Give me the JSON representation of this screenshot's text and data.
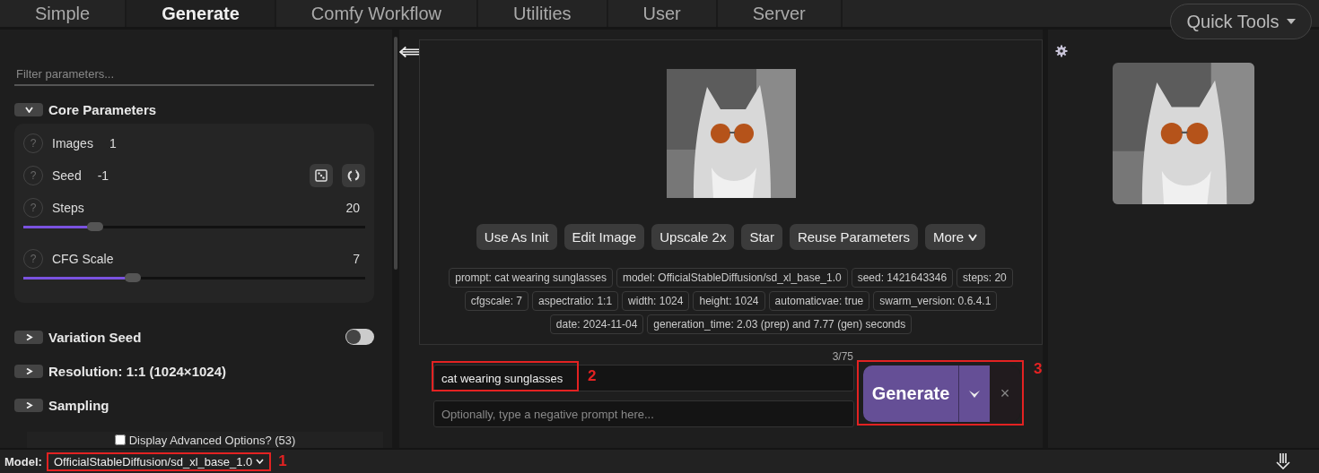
{
  "tabs": [
    {
      "label": "Simple",
      "selected": false
    },
    {
      "label": "Generate",
      "selected": true
    },
    {
      "label": "Comfy Workflow",
      "selected": false
    },
    {
      "label": "Utilities",
      "selected": false
    },
    {
      "label": "User",
      "selected": false
    },
    {
      "label": "Server",
      "selected": false
    }
  ],
  "quick_tools": {
    "label": "Quick Tools"
  },
  "sidebar": {
    "filter": {
      "placeholder": "Filter parameters..."
    },
    "groups": [
      {
        "title": "Core Parameters",
        "expanded": true,
        "params": [
          {
            "kind": "number",
            "help": "?",
            "label": "Images",
            "value": "1"
          },
          {
            "kind": "seed",
            "help": "?",
            "label": "Seed",
            "value": "-1"
          },
          {
            "kind": "slider",
            "help": "?",
            "label": "Steps",
            "value": "20",
            "level": 0.21
          },
          {
            "kind": "slider",
            "help": "?",
            "label": "CFG Scale",
            "value": "7",
            "level": 0.32
          }
        ]
      },
      {
        "title": "Variation Seed",
        "expanded": false,
        "toggle": {
          "on": false
        }
      },
      {
        "title": "Resolution: 1:1 (1024×1024)",
        "expanded": false
      },
      {
        "title": "Sampling",
        "expanded": false
      }
    ],
    "advanced": {
      "label": "Display Advanced Options? (53)",
      "checked": false
    }
  },
  "result": {
    "buttons": [
      "Use As Init",
      "Edit Image",
      "Upscale 2x",
      "Star",
      "Reuse Parameters",
      "More"
    ],
    "metadata": [
      [
        "prompt: cat wearing sunglasses",
        "model: OfficialStableDiffusion/sd_xl_base_1.0",
        "seed: 1421643346",
        "steps: 20"
      ],
      [
        "cfgscale: 7",
        "aspectratio: 1:1",
        "width: 1024",
        "height: 1024",
        "automaticvae: true",
        "swarm_version: 0.6.4.1"
      ],
      [
        "date: 2024-11-04",
        "generation_time: 2.03 (prep) and 7.77 (gen) seconds"
      ]
    ]
  },
  "prompt": {
    "counter": "3/75",
    "value": "cat wearing sunglasses",
    "negative_placeholder": "Optionally, type a negative prompt here..."
  },
  "generate": {
    "label": "Generate",
    "cancel": "×"
  },
  "status_bar": {
    "model_label": "Model:",
    "model": "OfficialStableDiffusion/sd_xl_base_1.0"
  },
  "annotations": [
    "1",
    "2",
    "3"
  ]
}
